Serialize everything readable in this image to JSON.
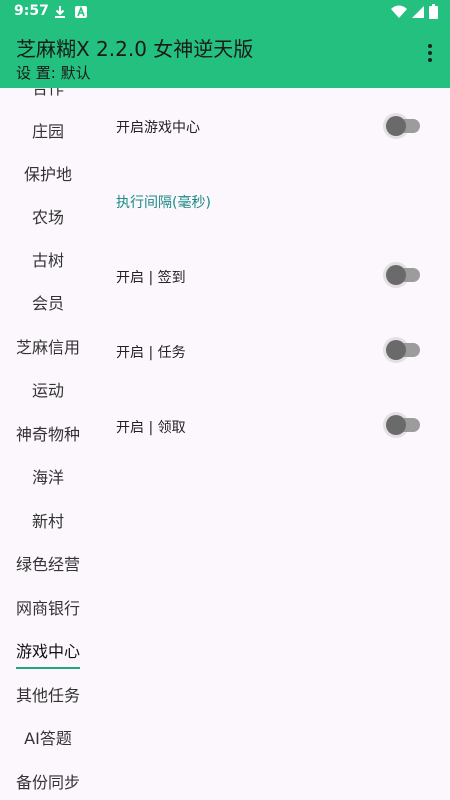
{
  "status_bar": {
    "time": "9:57",
    "left_icons": [
      "download-icon",
      "app-icon"
    ],
    "right_icons": [
      "wifi-icon",
      "signal-icon",
      "battery-icon"
    ]
  },
  "toolbar": {
    "title": "芝麻糊X 2.2.0 女神逆天版",
    "subtitle": "设 置: 默认",
    "menu_icon": "more-vert-icon",
    "color": "#23c07f"
  },
  "nav": {
    "items": [
      {
        "label": "合作"
      },
      {
        "label": "庄园"
      },
      {
        "label": "保护地"
      },
      {
        "label": "农场"
      },
      {
        "label": "古树"
      },
      {
        "label": "会员"
      },
      {
        "label": "芝麻信用"
      },
      {
        "label": "运动"
      },
      {
        "label": "神奇物种"
      },
      {
        "label": "海洋"
      },
      {
        "label": "新村"
      },
      {
        "label": "绿色经营"
      },
      {
        "label": "网商银行"
      },
      {
        "label": "游戏中心"
      },
      {
        "label": "其他任务"
      },
      {
        "label": "AI答题"
      },
      {
        "label": "备份同步"
      }
    ],
    "active": "游戏中心",
    "active_color": "#1fa77f"
  },
  "settings": {
    "open_game_center": {
      "label": "开启游戏中心",
      "enabled": false
    },
    "interval": {
      "label": "执行间隔(毫秒)"
    },
    "sign_in": {
      "label": "开启 | 签到",
      "enabled": false
    },
    "task": {
      "label": "开启 | 任务",
      "enabled": false
    },
    "claim": {
      "label": "开启 | 领取",
      "enabled": false
    }
  }
}
